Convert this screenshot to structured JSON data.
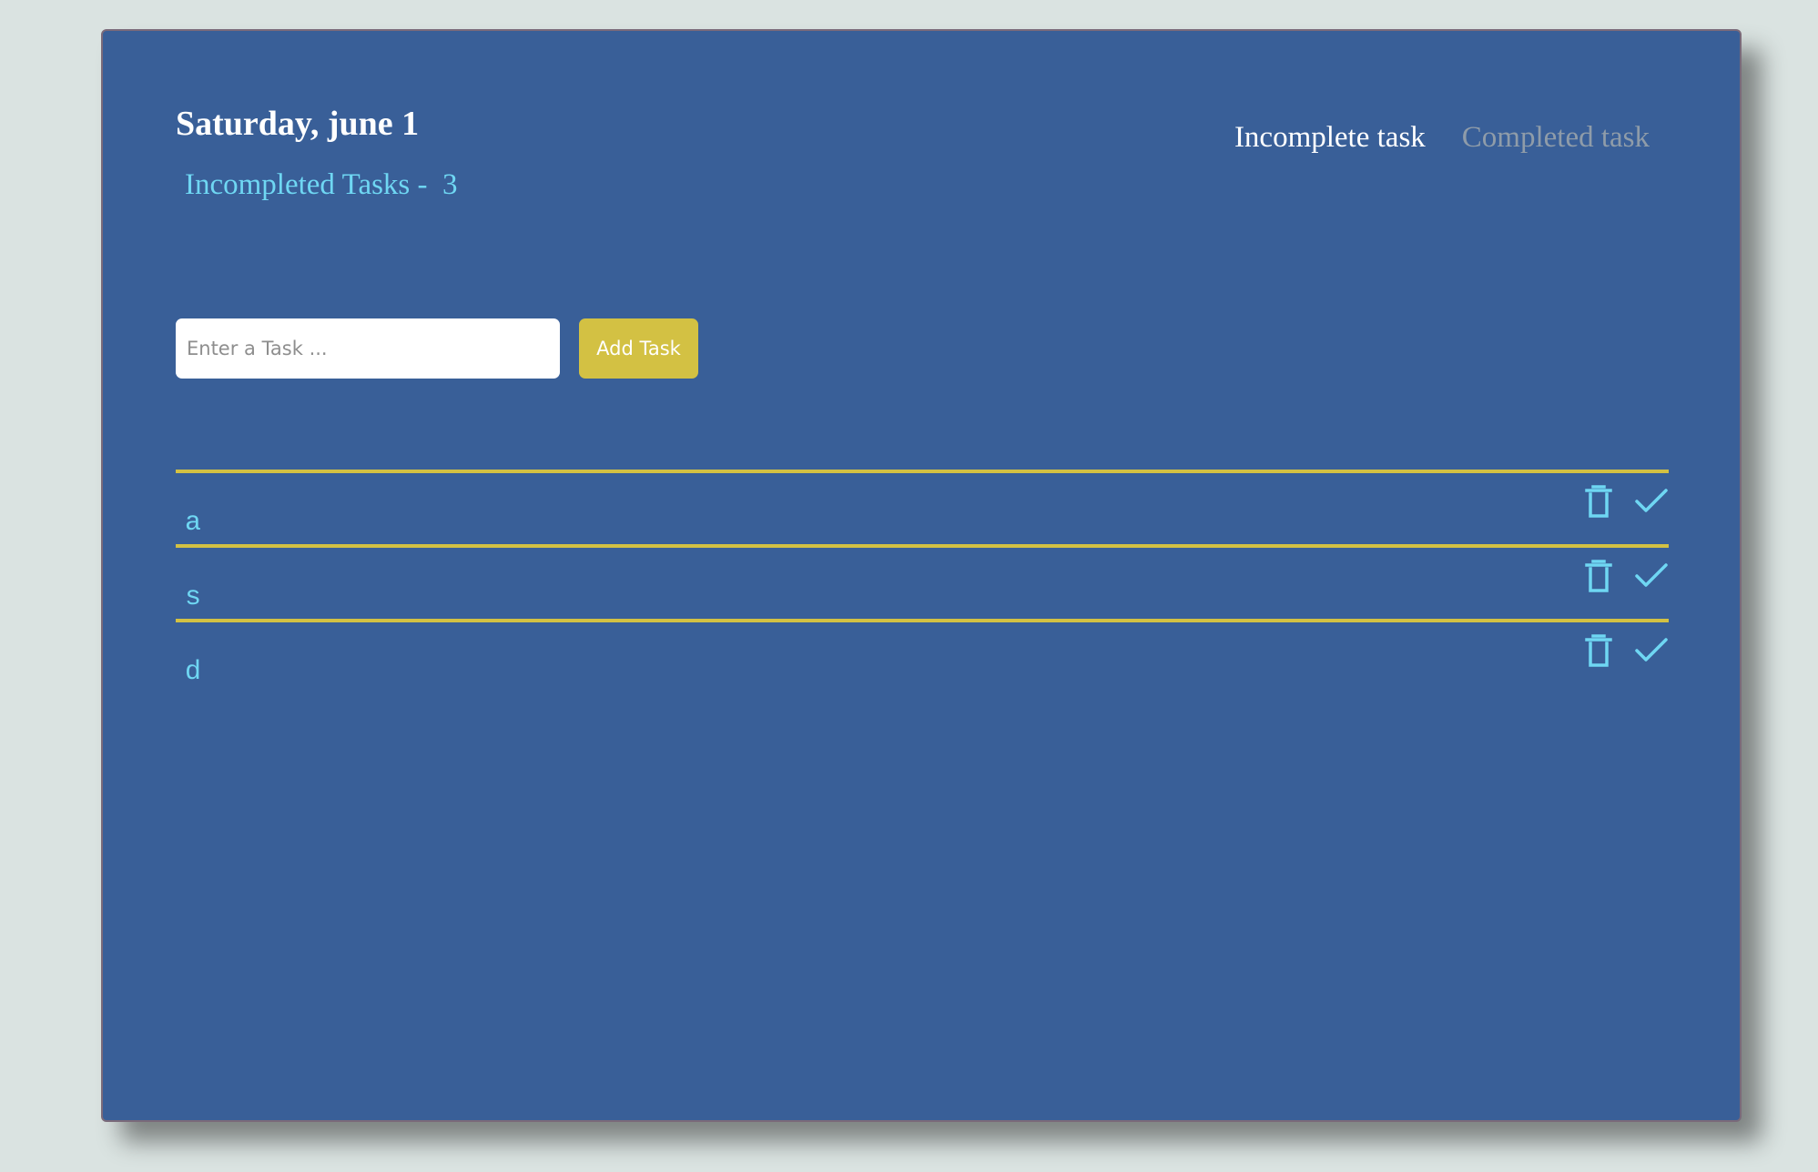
{
  "header": {
    "date": "Saturday, june 1",
    "counter_label": "Incompleted Tasks -  ",
    "counter_value": "3"
  },
  "tabs": [
    {
      "label": "Incomplete task",
      "active": true
    },
    {
      "label": "Completed task",
      "active": false
    }
  ],
  "form": {
    "placeholder": "Enter a Task ...",
    "value": "",
    "add_label": "Add Task"
  },
  "tasks": [
    {
      "text": "a",
      "delete_icon": "trash-icon",
      "complete_icon": "checkmark-icon"
    },
    {
      "text": "s",
      "delete_icon": "trash-icon",
      "complete_icon": "checkmark-icon"
    },
    {
      "text": "d",
      "delete_icon": "trash-icon",
      "complete_icon": "checkmark-icon"
    }
  ],
  "colors": {
    "background": "#dae3e1",
    "card": "#395f98",
    "accent": "#d3c143",
    "cyan": "#6fd7f3",
    "active_tab": "#ffffff",
    "inactive_tab": "#8f9ca9"
  }
}
